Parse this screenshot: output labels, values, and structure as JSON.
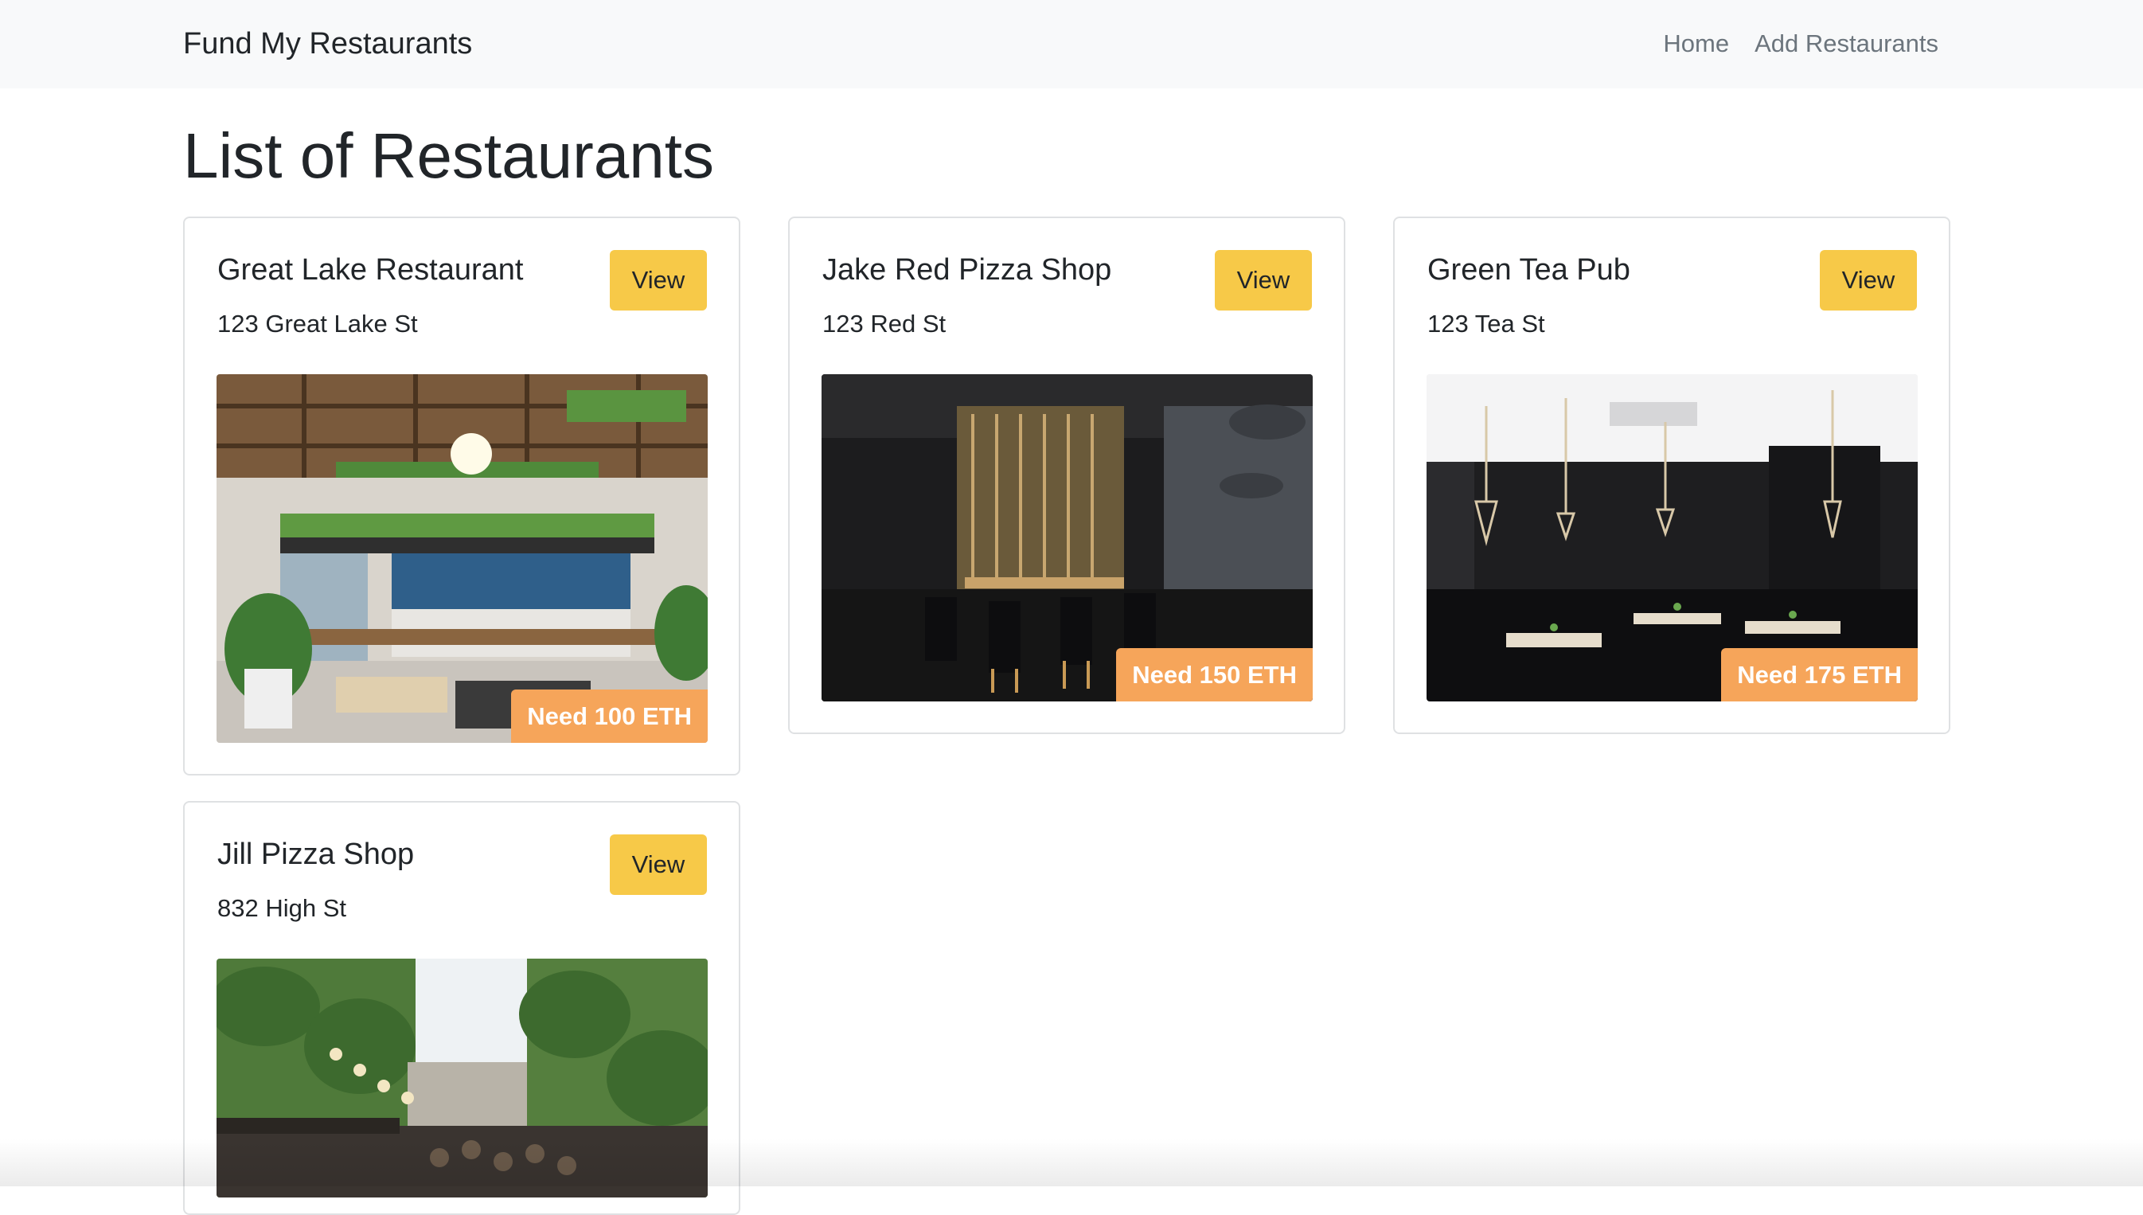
{
  "navbar": {
    "brand": "Fund My Restaurants",
    "links": [
      {
        "label": "Home"
      },
      {
        "label": "Add Restaurants"
      }
    ]
  },
  "page": {
    "title": "List of Restaurants"
  },
  "colors": {
    "view_button": "#f7c948",
    "eth_badge": "#f6a55a",
    "navbar_bg": "#f8f9fa"
  },
  "restaurants": [
    {
      "name": "Great Lake Restaurant",
      "address": "123 Great Lake St",
      "view_label": "View",
      "need_label": "Need 100 ETH",
      "image_icon": "restaurant-photo-cafeteria"
    },
    {
      "name": "Jake Red Pizza Shop",
      "address": "123 Red St",
      "view_label": "View",
      "need_label": "Need 150 ETH",
      "image_icon": "restaurant-photo-dark-dining"
    },
    {
      "name": "Green Tea Pub",
      "address": "123 Tea St",
      "view_label": "View",
      "need_label": "Need 175 ETH",
      "image_icon": "restaurant-photo-pub"
    },
    {
      "name": "Jill Pizza Shop",
      "address": "832 High St",
      "view_label": "View",
      "image_icon": "restaurant-photo-arcade"
    }
  ]
}
